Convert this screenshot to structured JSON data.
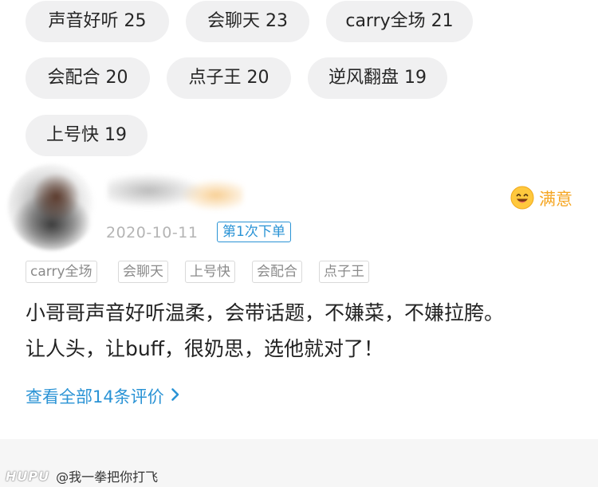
{
  "tags": [
    {
      "label": "声音好听",
      "count": "25"
    },
    {
      "label": "会聊天",
      "count": "23"
    },
    {
      "label": "carry全场",
      "count": "21"
    },
    {
      "label": "会配合",
      "count": "20"
    },
    {
      "label": "点子王",
      "count": "20"
    },
    {
      "label": "逆风翻盘",
      "count": "19"
    },
    {
      "label": "上号快",
      "count": "19"
    }
  ],
  "review": {
    "date": "2020-10-11",
    "order_badge": "第1次下单",
    "rating_label": "满意",
    "rating_icon": "smile-emoji-icon",
    "tags": [
      "carry全场",
      "会聊天",
      "上号快",
      "会配合",
      "点子王"
    ],
    "text_lines": [
      "小哥哥声音好听温柔，会带话题，不嫌菜，不嫌拉胯。",
      "让人头，让buff，很奶思，选他就对了！"
    ]
  },
  "view_all": {
    "label": "查看全部14条评价",
    "icon": "chevron-right-icon"
  },
  "watermark": {
    "logo": "HUPU",
    "user": "@我一拳把你打飞"
  },
  "colors": {
    "accent_blue": "#2a93d5",
    "rating_orange": "#f5a623",
    "pill_bg": "#f0f0f1"
  }
}
